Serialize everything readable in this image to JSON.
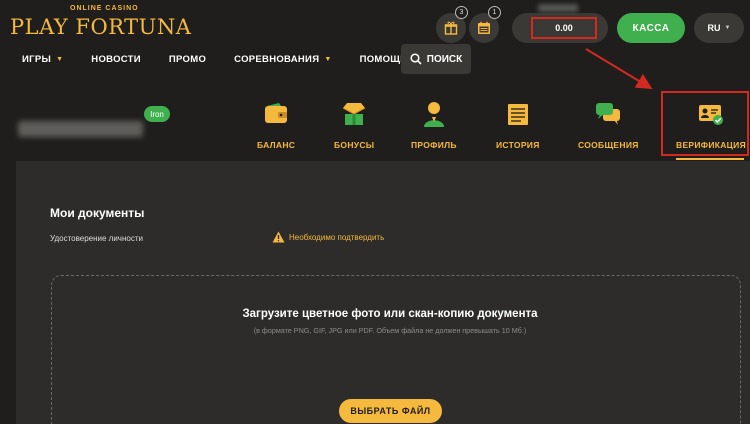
{
  "brand": {
    "tagline": "ONLINE CASINO",
    "name": "PLAY FORTUNA"
  },
  "header": {
    "gift_count": "3",
    "calendar_count": "1",
    "balance": "0.00",
    "cashier_label": "КАССА",
    "language": "RU"
  },
  "nav": {
    "items": [
      {
        "label": "ИГРЫ",
        "has_dropdown": true
      },
      {
        "label": "НОВОСТИ",
        "has_dropdown": false
      },
      {
        "label": "ПРОМО",
        "has_dropdown": false
      },
      {
        "label": "СОРЕВНОВАНИЯ",
        "has_dropdown": true
      },
      {
        "label": "ПОМОЩЬ",
        "has_dropdown": false
      }
    ],
    "search_label": "ПОИСК"
  },
  "profile": {
    "rank": "Iron"
  },
  "tabs": [
    {
      "label": "БАЛАНС",
      "icon": "wallet-icon"
    },
    {
      "label": "БОНУСЫ",
      "icon": "gift-diamond-icon"
    },
    {
      "label": "ПРОФИЛЬ",
      "icon": "person-icon"
    },
    {
      "label": "ИСТОРИЯ",
      "icon": "list-icon"
    },
    {
      "label": "СООБЩЕНИЯ",
      "icon": "chat-icon"
    },
    {
      "label": "ВЕРИФИКАЦИЯ",
      "icon": "id-card-check-icon",
      "active": true
    }
  ],
  "documents": {
    "title": "Мои документы",
    "rows": [
      {
        "label": "Удостоверение личности",
        "status": "Необходимо подтвердить"
      }
    ]
  },
  "upload": {
    "title": "Загрузите цветное фото или скан-копию документа",
    "hint": "(в формате PNG, GIF, JPG или PDF. Объем файла не должен превышать 10 Мб.)",
    "button_label": "ВЫБРАТЬ ФАЙЛ"
  },
  "colors": {
    "accent": "#f5b93d",
    "green": "#3fb04d",
    "highlight_red": "#d22a1e",
    "background": "#1f1e1c",
    "panel": "#2d2c2a"
  }
}
